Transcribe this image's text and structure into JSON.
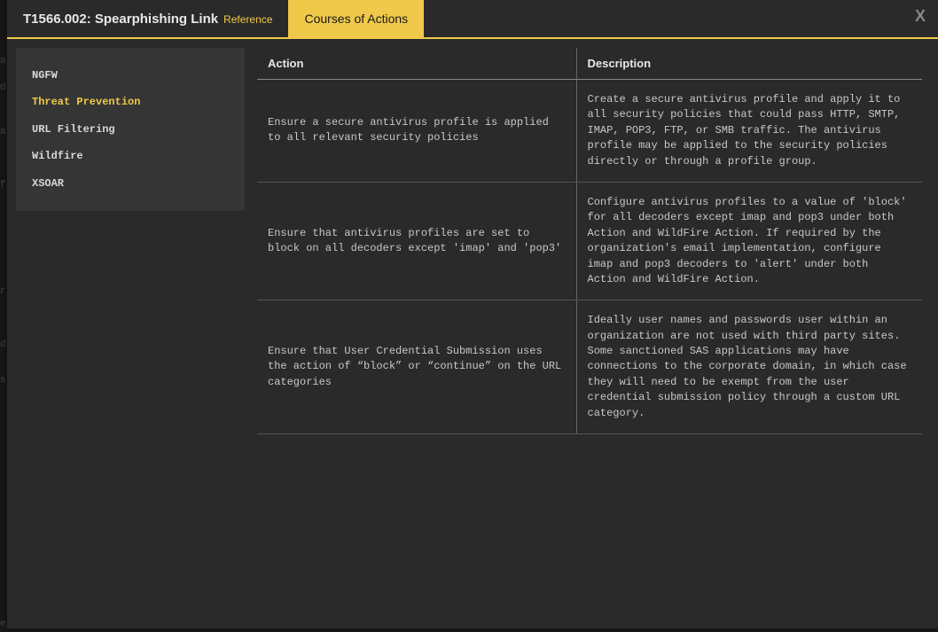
{
  "header": {
    "title": "T1566.002: Spearphishing Link",
    "reference_label": "Reference",
    "tab_active": "Courses of Actions",
    "close_label": "X"
  },
  "sidebar": {
    "items": [
      {
        "label": "NGFW",
        "active": false
      },
      {
        "label": "Threat Prevention",
        "active": true
      },
      {
        "label": "URL Filtering",
        "active": false
      },
      {
        "label": "Wildfire",
        "active": false
      },
      {
        "label": "XSOAR",
        "active": false
      }
    ]
  },
  "table": {
    "headers": {
      "action": "Action",
      "description": "Description"
    },
    "rows": [
      {
        "action": "Ensure a secure antivirus profile is applied to all relevant security policies",
        "description": "Create a secure antivirus profile and apply it to all security policies that could pass HTTP, SMTP, IMAP, POP3, FTP, or SMB traffic. The antivirus profile may be applied to the security policies directly or through a profile group."
      },
      {
        "action": "Ensure that antivirus profiles are set to block on all decoders except 'imap' and 'pop3'",
        "description": "Configure antivirus profiles to a value of 'block' for all decoders except imap and pop3 under both Action and WildFire Action. If required by the organization's email implementation, configure imap and pop3 decoders to 'alert' under both Action and WildFire Action."
      },
      {
        "action": "Ensure that User Credential Submission uses the action of “block” or “continue” on the URL categories",
        "description": "Ideally user names and passwords user within an organization are not used with third party sites. Some sanctioned SAS applications may have connections to the corporate domain, in which case they will need to be exempt from the user credential submission policy through a custom URL category."
      }
    ]
  },
  "backdrop": {
    "fragments": [
      "a",
      "d",
      "as",
      "f",
      "r",
      "d",
      "s",
      "e"
    ]
  }
}
